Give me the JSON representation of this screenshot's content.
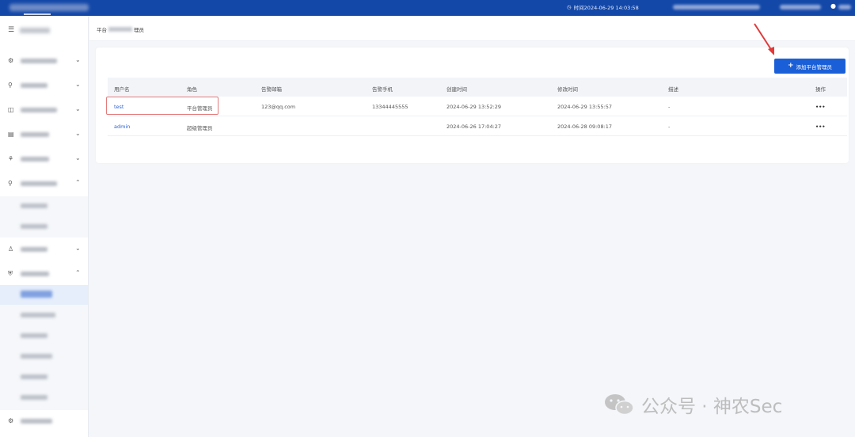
{
  "header": {
    "time_label": "时间2024-06-29 14:03:58"
  },
  "breadcrumb": {
    "prefix": "平台",
    "suffix": "理员"
  },
  "toolbar": {
    "add_label": "添加平台管理员"
  },
  "table": {
    "columns": [
      "用户名",
      "角色",
      "告警邮箱",
      "告警手机",
      "创建时间",
      "修改时间",
      "描述",
      "操作"
    ],
    "rows": [
      {
        "username": "test",
        "role": "平台管理员",
        "email": "123@qq.com",
        "phone": "13344445555",
        "created": "2024-06-29 13:52:29",
        "modified": "2024-06-29 13:55:57",
        "desc": "-",
        "action": "•••"
      },
      {
        "username": "admin",
        "role": "超级管理员",
        "email": "",
        "phone": "",
        "created": "2024-06-26 17:04:27",
        "modified": "2024-06-28 09:08:17",
        "desc": "-",
        "action": "•••"
      }
    ]
  },
  "watermark": {
    "text": "公众号 · 神农Sec"
  },
  "colors": {
    "topbar": "#1348a8",
    "primary": "#1a5fd8",
    "link": "#2a62d6",
    "highlight": "#e37b7b",
    "arrow": "#e03a3a"
  },
  "icons": {
    "collapse": "menu-fold-icon",
    "expand_down": "chevron-down-icon",
    "expand_up": "chevron-up-icon",
    "plus": "plus-icon",
    "clock": "clock-icon",
    "user": "user-icon",
    "more": "ellipsis-icon"
  }
}
